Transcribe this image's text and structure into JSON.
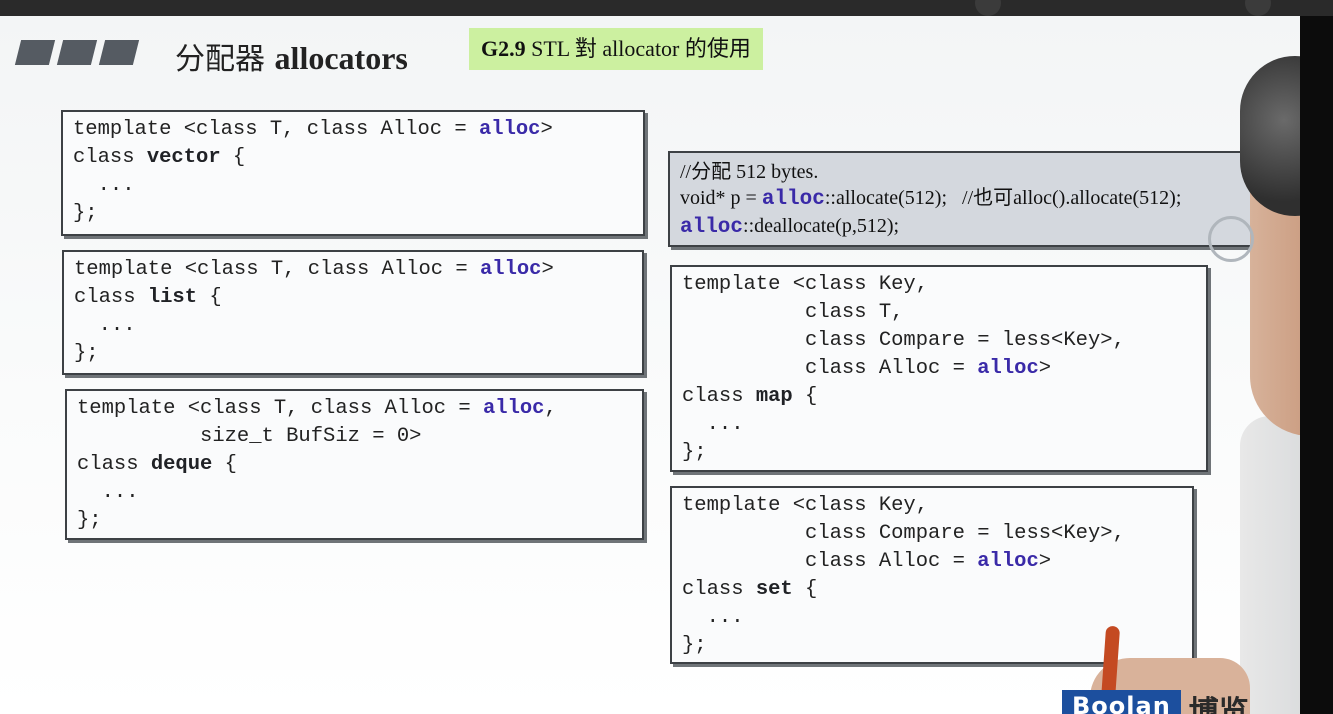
{
  "slide": {
    "title_cn": "分配器",
    "title_en": "allocators",
    "subtitle_version": "G2.9",
    "subtitle_text": " STL 對 allocator 的使用"
  },
  "code": {
    "vector": {
      "line1_a": "template <class T, class Alloc = ",
      "line1_alloc": "alloc",
      "line1_b": ">",
      "line2_a": "class ",
      "line2_name": "vector",
      "line2_b": " {",
      "line3": "  ...",
      "line4": "};"
    },
    "list": {
      "line1_a": "template <class T, class Alloc = ",
      "line1_alloc": "alloc",
      "line1_b": ">",
      "line2_a": "class ",
      "line2_name": "list",
      "line2_b": " {",
      "line3": "  ...",
      "line4": "};"
    },
    "deque": {
      "line1_a": "template <class T, class Alloc = ",
      "line1_alloc": "alloc",
      "line1_b": ",",
      "line2": "          size_t BufSiz = 0>",
      "line3_a": "class ",
      "line3_name": "deque",
      "line3_b": " {",
      "line4": "  ...",
      "line5": "};"
    },
    "map": {
      "line1": "template <class Key,",
      "line2": "          class T,",
      "line3": "          class Compare = less<Key>,",
      "line4_a": "          class Alloc = ",
      "line4_alloc": "alloc",
      "line4_b": ">",
      "line5_a": "class ",
      "line5_name": "map",
      "line5_b": " {",
      "line6": "  ...",
      "line7": "};"
    },
    "set": {
      "line1": "template <class Key,",
      "line2": "          class Compare = less<Key>,",
      "line3_a": "          class Alloc = ",
      "line3_alloc": "alloc",
      "line3_b": ">",
      "line4_a": "class ",
      "line4_name": "set",
      "line4_b": " {",
      "line5": "  ...",
      "line6": "};"
    }
  },
  "note": {
    "line1": "//分配 512 bytes.",
    "line2_a": "void* p = ",
    "line2_alloc": "alloc",
    "line2_b": "::allocate(512);   //也可alloc().allocate(512);",
    "line3_alloc": "alloc",
    "line3_b": "::deallocate(p,512);"
  },
  "watermark": {
    "brand": "Boolan",
    "brand_cn": "博览"
  },
  "colors": {
    "alloc_keyword": "#3a2aa8",
    "subtitle_bg": "#ccf0a0",
    "note_bg": "#d4d8de",
    "logo_bg": "#1c4f9e"
  }
}
